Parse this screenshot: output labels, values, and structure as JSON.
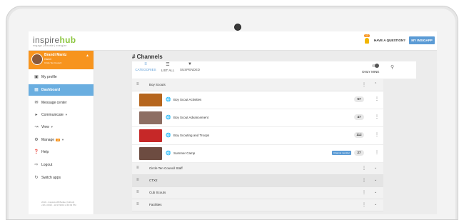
{
  "brand": {
    "logo_main": "inspire",
    "logo_accent": "hub",
    "tagline": "engage | elevate | energize"
  },
  "header": {
    "notification_count": "12",
    "question_label": "HAVE A QUESTION?",
    "hub_button_label": "MY INSIGAPP"
  },
  "user": {
    "name": "Brandi Mantz",
    "role": "Owner",
    "org": "Circle Ten Council"
  },
  "sidebar": {
    "items": [
      {
        "label": "My profile",
        "icon": "id-card-icon"
      },
      {
        "label": "Dashboard",
        "icon": "dashboard-icon"
      },
      {
        "label": "Message center",
        "icon": "envelope-icon"
      },
      {
        "label": "Communicate",
        "icon": "megaphone-icon"
      },
      {
        "label": "View",
        "icon": "chart-icon"
      },
      {
        "label": "Manage",
        "icon": "gear-icon",
        "badge": "3"
      },
      {
        "label": "Help",
        "icon": "help-icon"
      },
      {
        "label": "Logout",
        "icon": "logout-icon"
      },
      {
        "label": "Switch apps",
        "icon": "switch-icon"
      }
    ],
    "footer": "2019 - InspireHUB Builder [Github] v18.4.0016 - 11/17/2019 2:49:09 PM"
  },
  "page": {
    "title": "# Channels"
  },
  "tabs": [
    {
      "label": "CATEGORIES",
      "icon": "tree-icon",
      "selected": true
    },
    {
      "label": "LIST ALL",
      "icon": "list-icon",
      "selected": false
    },
    {
      "label": "SUSPENDED",
      "icon": "thumb-down-icon",
      "selected": false
    }
  ],
  "only_mine_label": "ONLY MINE",
  "groups": [
    {
      "label": "Boy Scouts",
      "expanded": true,
      "channels": [
        {
          "label": "Boy Scout Activities",
          "count": "57",
          "thumb_color": "#b5651d"
        },
        {
          "label": "Boy Scout Advancement",
          "count": "47",
          "thumb_color": "#8d6e63"
        },
        {
          "label": "Boy Scouting and Troops",
          "count": "112",
          "thumb_color": "#c62828"
        },
        {
          "label": "Summer Camp",
          "count": "27",
          "thumb_color": "#6d4c41",
          "badge": "Channel member"
        }
      ]
    },
    {
      "label": "Circle Ten Council Staff"
    },
    {
      "label": "CTX2"
    },
    {
      "label": "Cub Scouts"
    },
    {
      "label": "Facilities"
    }
  ]
}
